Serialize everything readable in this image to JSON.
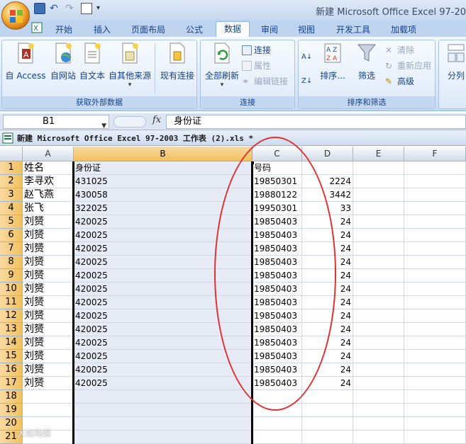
{
  "window": {
    "title": "新建 Microsoft Office Excel 97-20"
  },
  "tabs": [
    {
      "label": "开始"
    },
    {
      "label": "插入"
    },
    {
      "label": "页面布局"
    },
    {
      "label": "公式"
    },
    {
      "label": "数据"
    },
    {
      "label": "审阅"
    },
    {
      "label": "视图"
    },
    {
      "label": "开发工具"
    },
    {
      "label": "加载项"
    }
  ],
  "ribbon": {
    "external": {
      "label": "获取外部数据",
      "buttons": [
        "自 Access",
        "自网站",
        "自文本",
        "自其他来源",
        "现有连接"
      ]
    },
    "connections": {
      "label": "连接",
      "refresh": "全部刷新",
      "connect": "连接",
      "props": "属性",
      "editlinks": "编辑链接"
    },
    "sortfilter": {
      "label": "排序和筛选",
      "sort": "排序...",
      "filter": "筛选",
      "clear": "清除",
      "reapply": "重新应用",
      "advanced": "高级"
    },
    "tools": {
      "split": "分列"
    }
  },
  "formula": {
    "cell": "B1",
    "fx": "fx",
    "content": "身份证"
  },
  "workbook": {
    "title": "新建 Microsoft Office Excel 97-2003 工作表 (2).xls *"
  },
  "grid": {
    "columns": [
      "A",
      "B",
      "C",
      "D",
      "E",
      "F"
    ],
    "rows": [
      "1",
      "2",
      "3",
      "4",
      "5",
      "6",
      "7",
      "8",
      "9",
      "10",
      "11",
      "12",
      "13",
      "14",
      "15",
      "16",
      "17",
      "18",
      "19",
      "20",
      "21"
    ],
    "data": [
      [
        "姓名",
        "身份证",
        "号码",
        ""
      ],
      [
        "李寻欢",
        "431025",
        "19850301",
        "2224"
      ],
      [
        "赵飞燕",
        "430058",
        "19880122",
        "3442"
      ],
      [
        "张飞",
        "322025",
        "19950301",
        "33"
      ],
      [
        "刘赟",
        "420025",
        "19850403",
        "24"
      ],
      [
        "刘赟",
        "420025",
        "19850403",
        "24"
      ],
      [
        "刘赟",
        "420025",
        "19850403",
        "24"
      ],
      [
        "刘赟",
        "420025",
        "19850403",
        "24"
      ],
      [
        "刘赟",
        "420025",
        "19850403",
        "24"
      ],
      [
        "刘赟",
        "420025",
        "19850403",
        "24"
      ],
      [
        "刘赟",
        "420025",
        "19850403",
        "24"
      ],
      [
        "刘赟",
        "420025",
        "19850403",
        "24"
      ],
      [
        "刘赟",
        "420025",
        "19850403",
        "24"
      ],
      [
        "刘赟",
        "420025",
        "19850403",
        "24"
      ],
      [
        "刘赟",
        "420025",
        "19850403",
        "24"
      ],
      [
        "刘赟",
        "420025",
        "19850403",
        "24"
      ],
      [
        "刘赟",
        "420025",
        "19850403",
        "24"
      ]
    ]
  },
  "watermark": "大就略跟",
  "colors": {
    "accent": "#f1c15f",
    "annotation": "#e03030",
    "ribbon": "#dde9f8"
  }
}
